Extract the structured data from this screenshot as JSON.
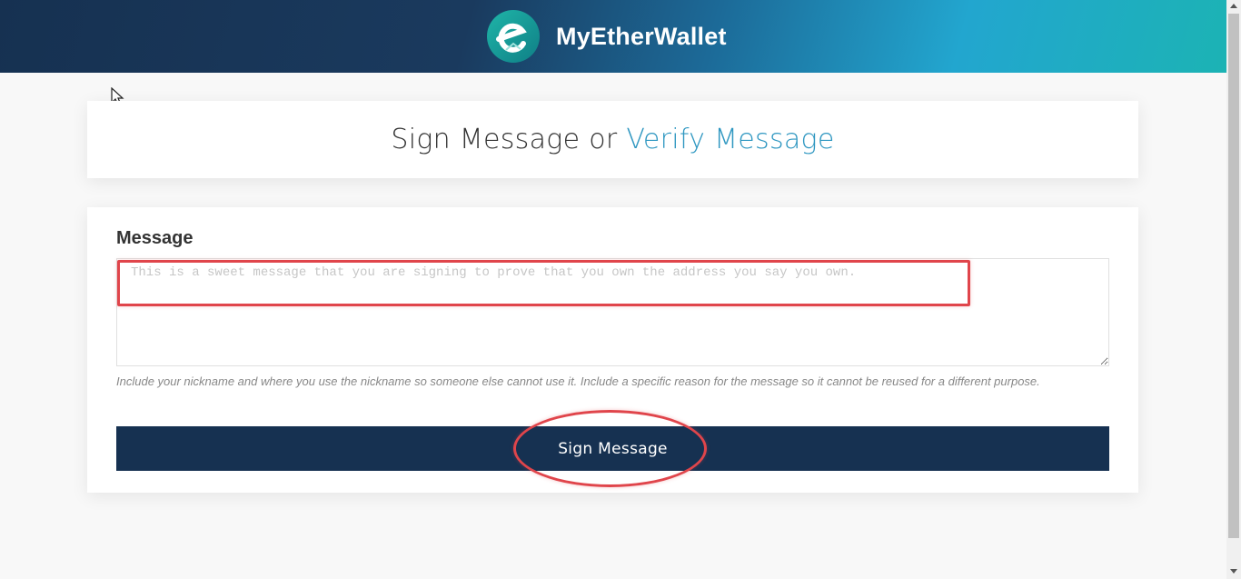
{
  "header": {
    "app_name": "MyEtherWallet",
    "logo_icon": "myetherwallet-logo-icon",
    "gradient_colors": [
      "#163151",
      "#1c6a98",
      "#22a6cf",
      "#1cb3b4"
    ]
  },
  "title_card": {
    "sign_text": "Sign Message",
    "or_text": " or ",
    "verify_link": "Verify Message",
    "link_color": "#2f97c1"
  },
  "message_form": {
    "label": "Message",
    "value": "",
    "placeholder": "This is a sweet message that you are signing to prove that you own the address you say you own.",
    "help_text": "Include your nickname and where you use the nickname so someone else cannot use it. Include a specific reason for the message so it cannot be reused for a different purpose.",
    "sign_button_label": "Sign Message",
    "button_color": "#163151"
  },
  "annotations": {
    "highlight_color": "#e0454b"
  }
}
